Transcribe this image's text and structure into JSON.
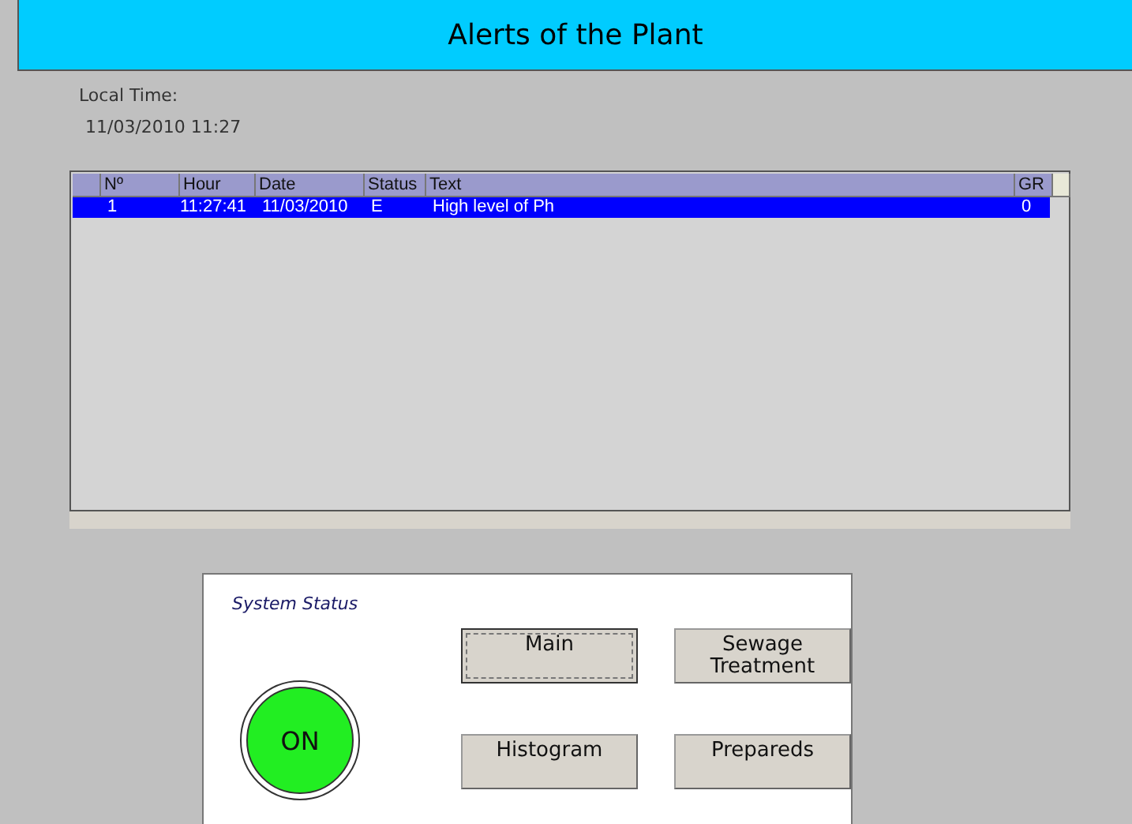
{
  "window": {
    "title": "Alerts of the Plant"
  },
  "local_time": {
    "label": "Local Time:",
    "value": "11/03/2010 11:27"
  },
  "table": {
    "columns": [
      "Nº",
      "Hour",
      "Date",
      "Status",
      "Text",
      "GR"
    ],
    "rows": [
      {
        "cells": [
          "1",
          "11:27:41",
          "11/03/2010",
          "E",
          "High level of Ph",
          "0"
        ],
        "selected": true
      }
    ]
  },
  "system_status": {
    "title": "System Status",
    "indicator": {
      "label": "ON",
      "on": true
    },
    "buttons": [
      {
        "label": "Main",
        "focused": true
      },
      {
        "label": "Sewage Treatment",
        "focused": false
      },
      {
        "label": "Histogram",
        "focused": false
      },
      {
        "label": "Prepareds",
        "focused": false
      }
    ]
  }
}
